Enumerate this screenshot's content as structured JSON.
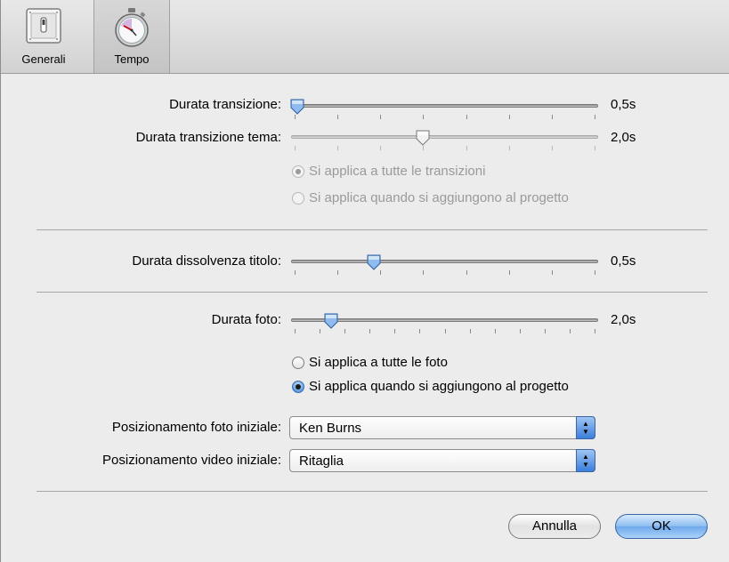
{
  "toolbar": {
    "generali_label": "Generali",
    "tempo_label": "Tempo"
  },
  "transitions": {
    "duration_label": "Durata transizione:",
    "duration_value": "0,5s",
    "duration_fraction": 0.02,
    "theme_label": "Durata transizione tema:",
    "theme_value": "2,0s",
    "theme_fraction": 0.43,
    "radio_all": "Si applica a tutte le transizioni",
    "radio_added": "Si applica quando si aggiungono al progetto"
  },
  "title_fade": {
    "label": "Durata dissolvenza titolo:",
    "value": "0,5s",
    "fraction": 0.27
  },
  "photo": {
    "label": "Durata foto:",
    "value": "2,0s",
    "fraction": 0.13,
    "radio_all": "Si applica a tutte le foto",
    "radio_added": "Si applica quando si aggiungono al progetto"
  },
  "placement": {
    "photo_label": "Posizionamento foto iniziale:",
    "photo_value": "Ken Burns",
    "video_label": "Posizionamento video iniziale:",
    "video_value": "Ritaglia"
  },
  "buttons": {
    "cancel": "Annulla",
    "ok": "OK"
  },
  "colors": {
    "accent": "#5d9ae0",
    "window_bg": "#ececec"
  }
}
